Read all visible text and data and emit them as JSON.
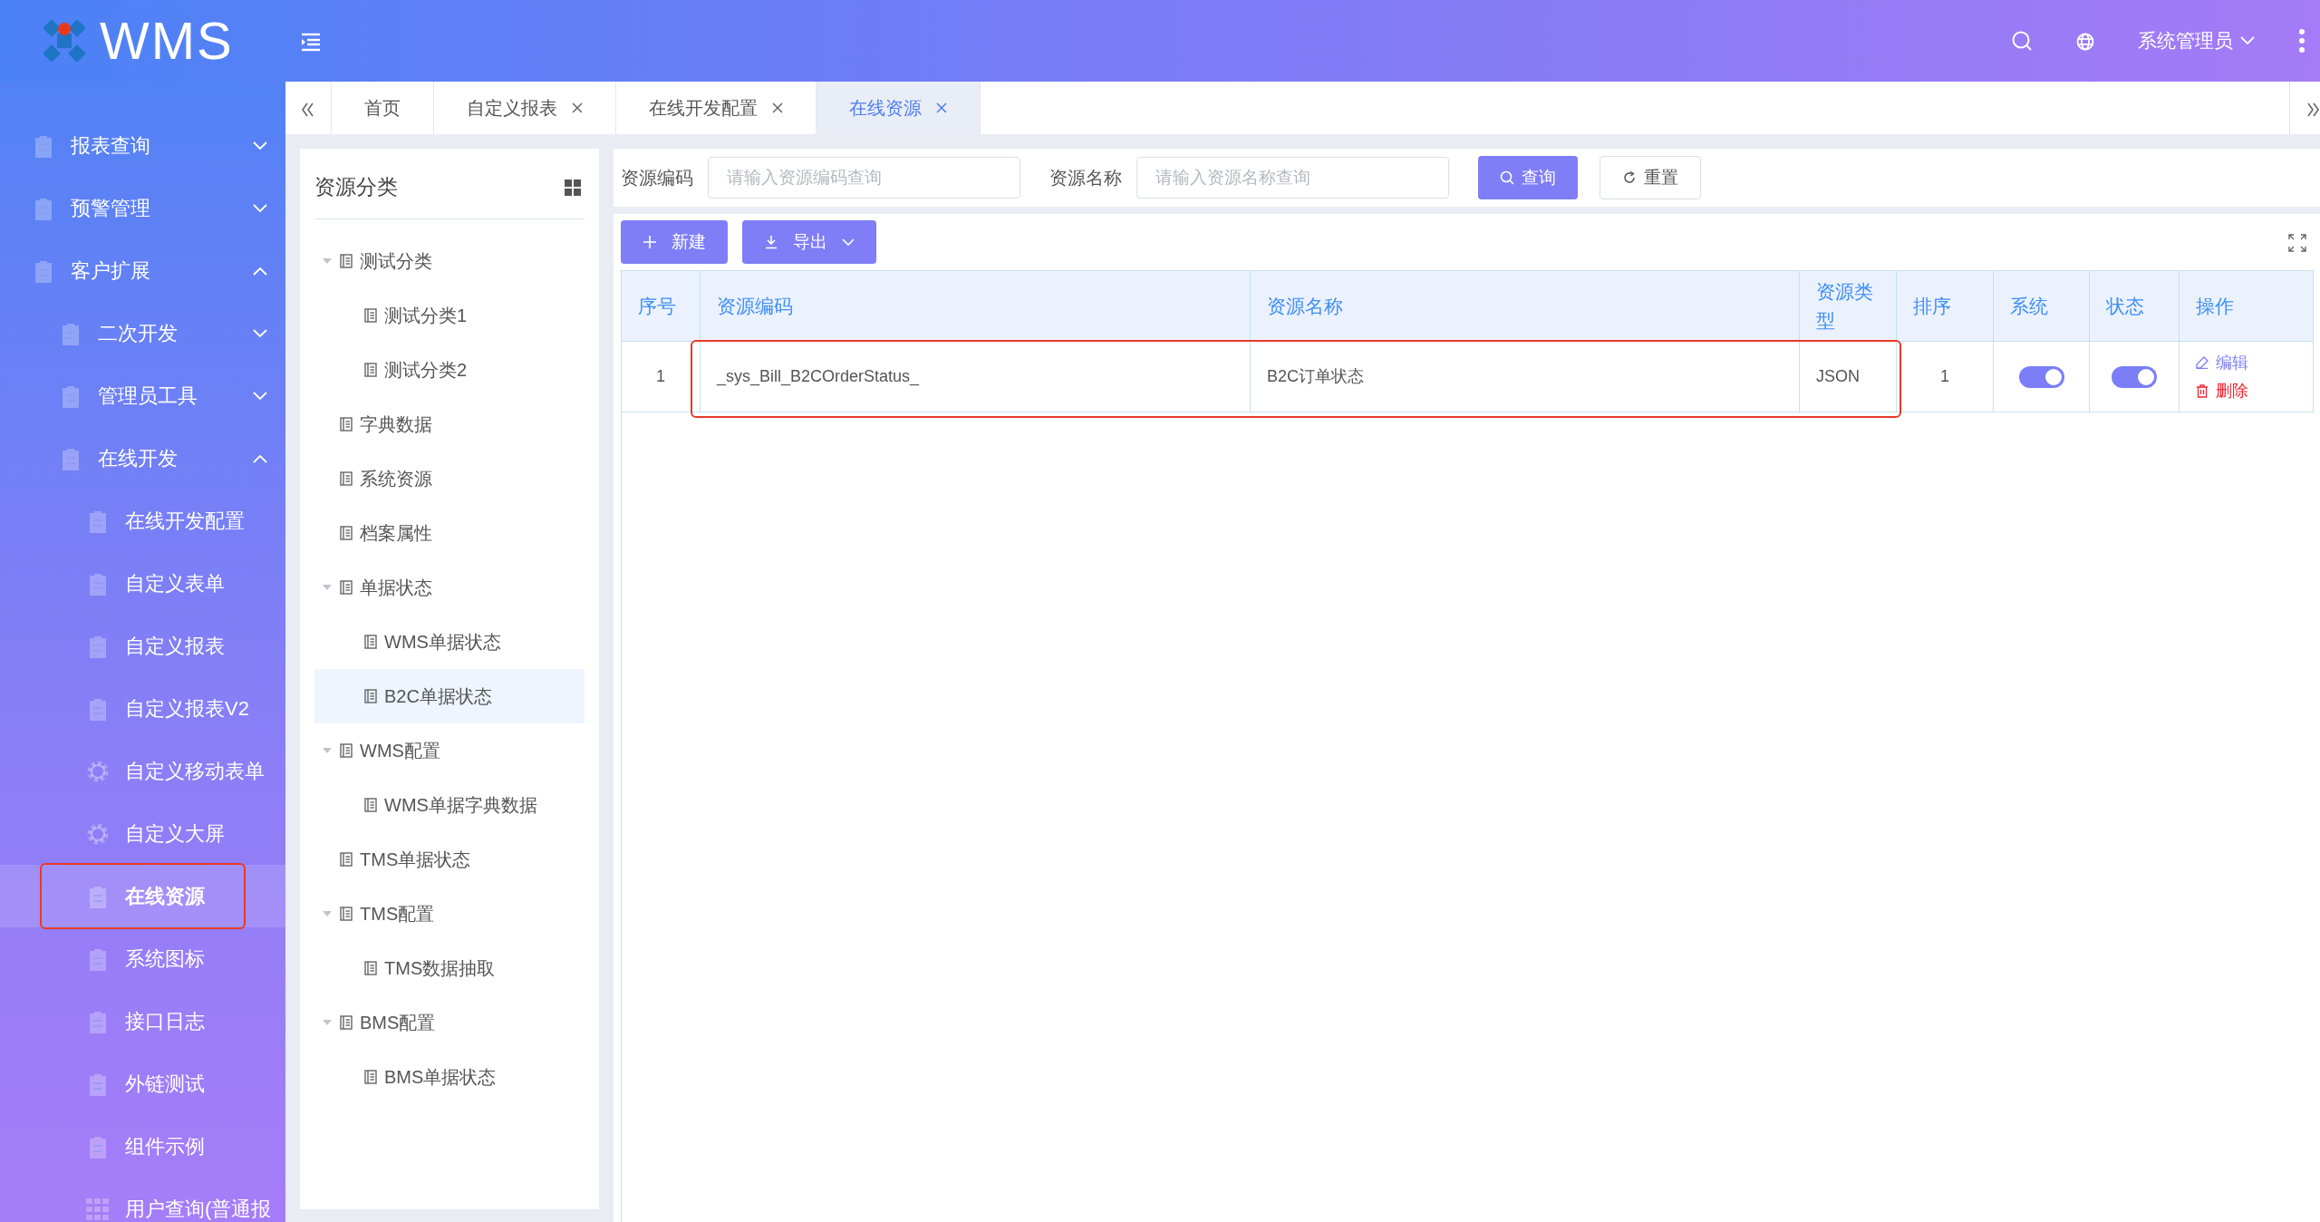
{
  "header": {
    "logo": "WMS",
    "user": "系统管理员"
  },
  "sidebar": {
    "items": [
      {
        "label": "报表查询",
        "kind": "page",
        "expanded": false
      },
      {
        "label": "预警管理",
        "kind": "page",
        "expanded": false
      },
      {
        "label": "客户扩展",
        "kind": "page",
        "expanded": true,
        "children": [
          {
            "label": "二次开发",
            "kind": "page",
            "expanded": false
          },
          {
            "label": "管理员工具",
            "kind": "page",
            "expanded": false
          },
          {
            "label": "在线开发",
            "kind": "page",
            "expanded": true,
            "children": [
              {
                "label": "在线开发配置",
                "kind": "page",
                "selected": false,
                "marked": false
              },
              {
                "label": "自定义表单",
                "kind": "page",
                "selected": false,
                "marked": false
              },
              {
                "label": "自定义报表",
                "kind": "page",
                "selected": false,
                "marked": false
              },
              {
                "label": "自定义报表V2",
                "kind": "page",
                "selected": false,
                "marked": false
              },
              {
                "label": "自定义移动表单",
                "kind": "gear",
                "selected": false,
                "marked": false
              },
              {
                "label": "自定义大屏",
                "kind": "gear",
                "selected": false,
                "marked": false
              },
              {
                "label": "在线资源",
                "kind": "page",
                "selected": true,
                "marked": true
              },
              {
                "label": "系统图标",
                "kind": "page",
                "selected": false,
                "marked": false
              },
              {
                "label": "接口日志",
                "kind": "page",
                "selected": false,
                "marked": false
              },
              {
                "label": "外链测试",
                "kind": "page",
                "selected": false,
                "marked": false
              },
              {
                "label": "组件示例",
                "kind": "page",
                "selected": false,
                "marked": false
              },
              {
                "label": "用户查询(普通报",
                "kind": "grid",
                "selected": false,
                "marked": false
              }
            ]
          }
        ]
      }
    ]
  },
  "tabs": [
    {
      "label": "首页",
      "closable": false,
      "selected": false
    },
    {
      "label": "自定义报表",
      "closable": true,
      "selected": false
    },
    {
      "label": "在线开发配置",
      "closable": true,
      "selected": false
    },
    {
      "label": "在线资源",
      "closable": true,
      "selected": true
    }
  ],
  "tree": {
    "title": "资源分类",
    "items": [
      {
        "label": "测试分类",
        "expanded": true,
        "selected": false,
        "children": [
          {
            "label": "测试分类1",
            "selected": false
          },
          {
            "label": "测试分类2",
            "selected": false
          }
        ]
      },
      {
        "label": "字典数据",
        "selected": false
      },
      {
        "label": "系统资源",
        "selected": false
      },
      {
        "label": "档案属性",
        "selected": false
      },
      {
        "label": "单据状态",
        "expanded": true,
        "selected": false,
        "children": [
          {
            "label": "WMS单据状态",
            "selected": false
          },
          {
            "label": "B2C单据状态",
            "selected": true
          }
        ]
      },
      {
        "label": "WMS配置",
        "expanded": true,
        "selected": false,
        "children": [
          {
            "label": "WMS单据字典数据",
            "selected": false
          }
        ]
      },
      {
        "label": "TMS单据状态",
        "selected": false
      },
      {
        "label": "TMS配置",
        "expanded": true,
        "selected": false,
        "children": [
          {
            "label": "TMS数据抽取",
            "selected": false
          }
        ]
      },
      {
        "label": "BMS配置",
        "expanded": true,
        "selected": false,
        "children": [
          {
            "label": "BMS单据状态",
            "selected": false
          }
        ]
      }
    ]
  },
  "search": {
    "fields": [
      {
        "label": "资源编码",
        "placeholder": "请输入资源编码查询"
      },
      {
        "label": "资源名称",
        "placeholder": "请输入资源名称查询"
      }
    ],
    "buttons": [
      {
        "label": "查询",
        "kind": "primary"
      },
      {
        "label": "重置",
        "kind": "default"
      }
    ]
  },
  "toolbar": {
    "buttons": [
      {
        "label": "新建",
        "kind": "add"
      },
      {
        "label": "导出",
        "kind": "export"
      }
    ]
  },
  "table": {
    "columns": [
      "序号",
      "资源编码",
      "资源名称",
      "资源类型",
      "排序",
      "系统",
      "状态",
      "操作"
    ],
    "rows": [
      {
        "index": "1",
        "code": "_sys_Bill_B2COrderStatus_",
        "name": "B2C订单状态",
        "type": "JSON",
        "sort": "1",
        "system": true,
        "status": true,
        "marked": true,
        "actions": [
          {
            "label": "编辑",
            "kind": "edit"
          },
          {
            "label": "删除",
            "kind": "delete"
          }
        ]
      }
    ]
  }
}
